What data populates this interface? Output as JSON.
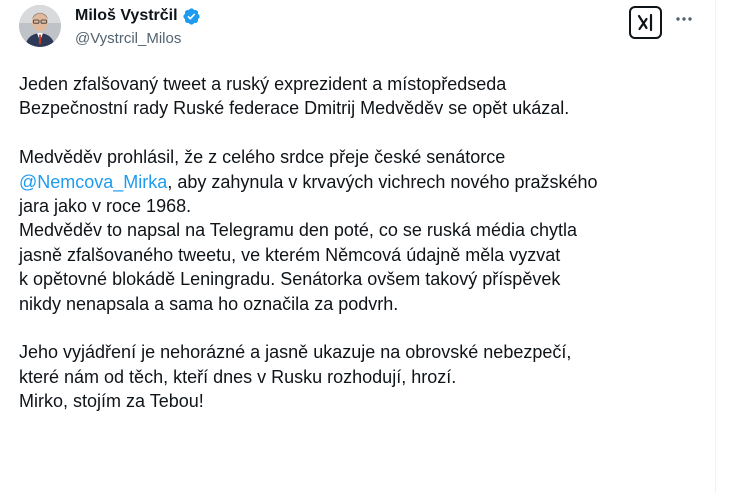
{
  "author": {
    "name": "Miloš Vystrčil",
    "handle": "@Vystrcil_Milos",
    "verified": true,
    "verified_color": "#1d9bf0"
  },
  "actions": {
    "grok_icon": "grok-icon",
    "more_icon": "more-icon"
  },
  "tweet": {
    "para1": [
      "Jeden zfalšovaný tweet a ruský exprezident a místopředseda",
      "Bezpečnostní rady Ruské federace Dmitrij Medvěděv se opět ukázal."
    ],
    "para2": {
      "line1": "Medvěděv prohlásil, že z celého srdce přeje české senátorce",
      "mention": "@Nemcova_Mirka",
      "line2_rest": ", aby zahynula v krvavých vichrech nového pražského",
      "line3": "jara jako v roce 1968."
    },
    "para3": [
      "Medvěděv to napsal na Telegramu den poté, co se ruská média chytla",
      "jasně zfalšovaného tweetu, ve kterém Němcová údajně měla vyzvat",
      "k opětovné blokádě Leningradu. Senátorka ovšem takový příspěvek",
      "nikdy nenapsala a sama ho označila za podvrh."
    ],
    "para4": [
      "Jeho vyjádření je nehorázné a jasně ukazuje na obrovské nebezpečí,",
      "které nám od těch, kteří dnes v Rusku rozhodují, hrozí.",
      "Mirko, stojím za Tebou!"
    ],
    "link_color": "#1d9bf0"
  }
}
